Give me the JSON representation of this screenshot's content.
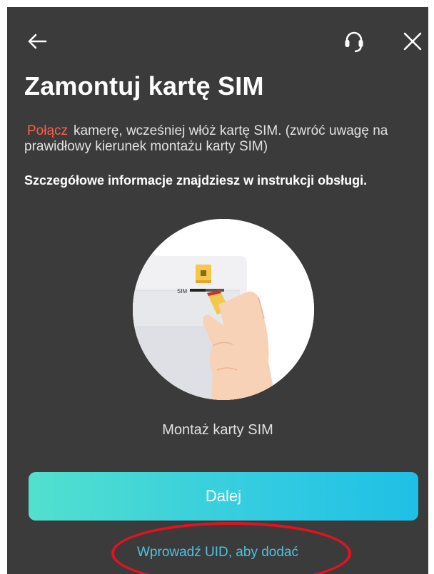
{
  "header": {
    "back_icon": "arrow-left-icon",
    "support_icon": "headset-icon",
    "close_icon": "close-icon"
  },
  "page": {
    "title": "Zamontuj kartę SIM",
    "description_highlight": "Połącz",
    "description_rest": "kamerę, wcześniej włóż kartę SIM. (zwróć uwagę na prawidłowy kierunek montażu karty SIM)",
    "detail_note": "Szczegółowe informacje znajdziesz w instrukcji obsługi.",
    "illustration_slot_label": "SIM",
    "illustration_caption": "Montaż karty SIM"
  },
  "actions": {
    "next_label": "Dalej",
    "uid_link_label": "Wprowadź UID, aby dodać"
  },
  "colors": {
    "background": "#3b3b3b",
    "highlight": "#ff5e4a",
    "link": "#4fc3df",
    "button_gradient_start": "#52e0cd",
    "button_gradient_end": "#1fc0e6",
    "annotation": "#e3121f"
  }
}
